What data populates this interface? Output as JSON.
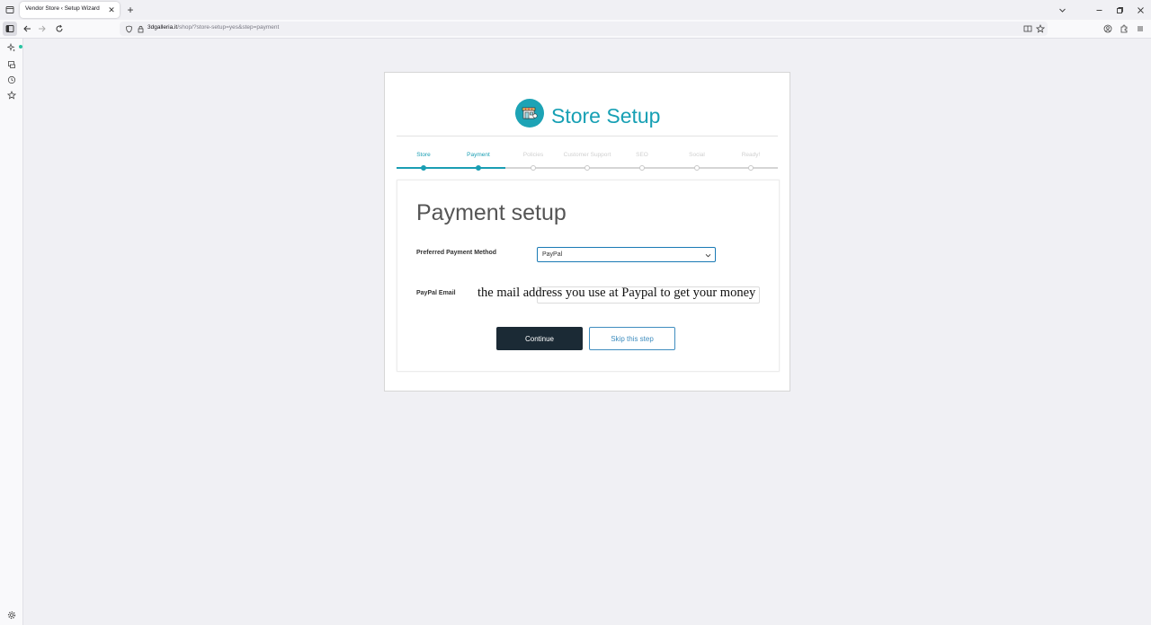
{
  "browser": {
    "tab_title": "Vendor Store ‹ Setup Wizard",
    "url_host": "3dgalleria.it",
    "url_path": "/shop/?store-setup=yes&step=payment"
  },
  "page": {
    "title": "Store Setup",
    "steps": [
      {
        "label": "Store",
        "state": "done"
      },
      {
        "label": "Payment",
        "state": "active"
      },
      {
        "label": "Policies",
        "state": "pending"
      },
      {
        "label": "Customer Support",
        "state": "pending"
      },
      {
        "label": "SEO",
        "state": "pending"
      },
      {
        "label": "Social",
        "state": "pending"
      },
      {
        "label": "Ready!",
        "state": "pending"
      }
    ],
    "section_title": "Payment setup",
    "payment_method_label": "Preferred Payment Method",
    "payment_method_value": "PayPal",
    "paypal_email_label": "PayPal Email",
    "paypal_email_placeholder": "the mail address you use at Paypal to get your money",
    "continue_label": "Continue",
    "skip_label": "Skip this step"
  },
  "colors": {
    "accent": "#1a9eb3",
    "dark_button": "#1b2a35",
    "link_blue": "#3f8dbf"
  },
  "icons": {
    "tab_list": "tab-list-icon",
    "sidebar": "sidebar-toggle-icon",
    "back": "back-arrow-icon",
    "forward": "forward-arrow-icon",
    "reload": "reload-icon",
    "shield": "tracking-shield-icon",
    "lock": "lock-icon",
    "reader": "reader-view-icon",
    "bookmark": "bookmark-star-icon",
    "account": "account-icon",
    "extensions": "extensions-icon",
    "menu": "hamburger-menu-icon",
    "ai": "ai-chatbot-icon",
    "synced_tabs": "synced-tabs-icon",
    "history": "history-icon",
    "bookmarks": "bookmarks-icon",
    "settings": "settings-gear-icon",
    "store_logo": "store-logo-icon"
  }
}
